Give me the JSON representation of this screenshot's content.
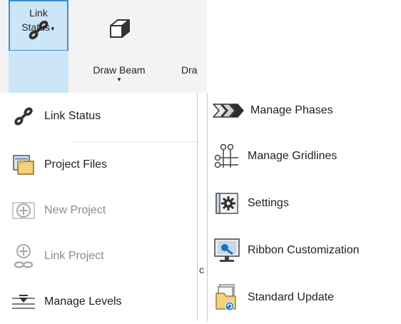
{
  "ribbon": {
    "link_status_line1": "Link",
    "link_status_line2": "Status",
    "draw_beam": "Draw Beam",
    "truncated": "Dra"
  },
  "menu_left": [
    {
      "label": "Link  Status",
      "enabled": true
    },
    {
      "label": "Project Files",
      "enabled": true
    },
    {
      "label": "New  Project",
      "enabled": false
    },
    {
      "label": "Link Project",
      "enabled": false
    },
    {
      "label": "Manage  Levels",
      "enabled": true
    }
  ],
  "menu_right": [
    {
      "label": "Manage  Phases"
    },
    {
      "label": "Manage  Gridlines"
    },
    {
      "label": "Settings"
    },
    {
      "label": "Ribbon  Customization"
    },
    {
      "label": "Standard Update"
    }
  ],
  "truncated_char": "c",
  "colors": {
    "accent": "#3c8fd3",
    "selected_bg": "#cde6f7",
    "disabled": "#8a8a8a"
  }
}
